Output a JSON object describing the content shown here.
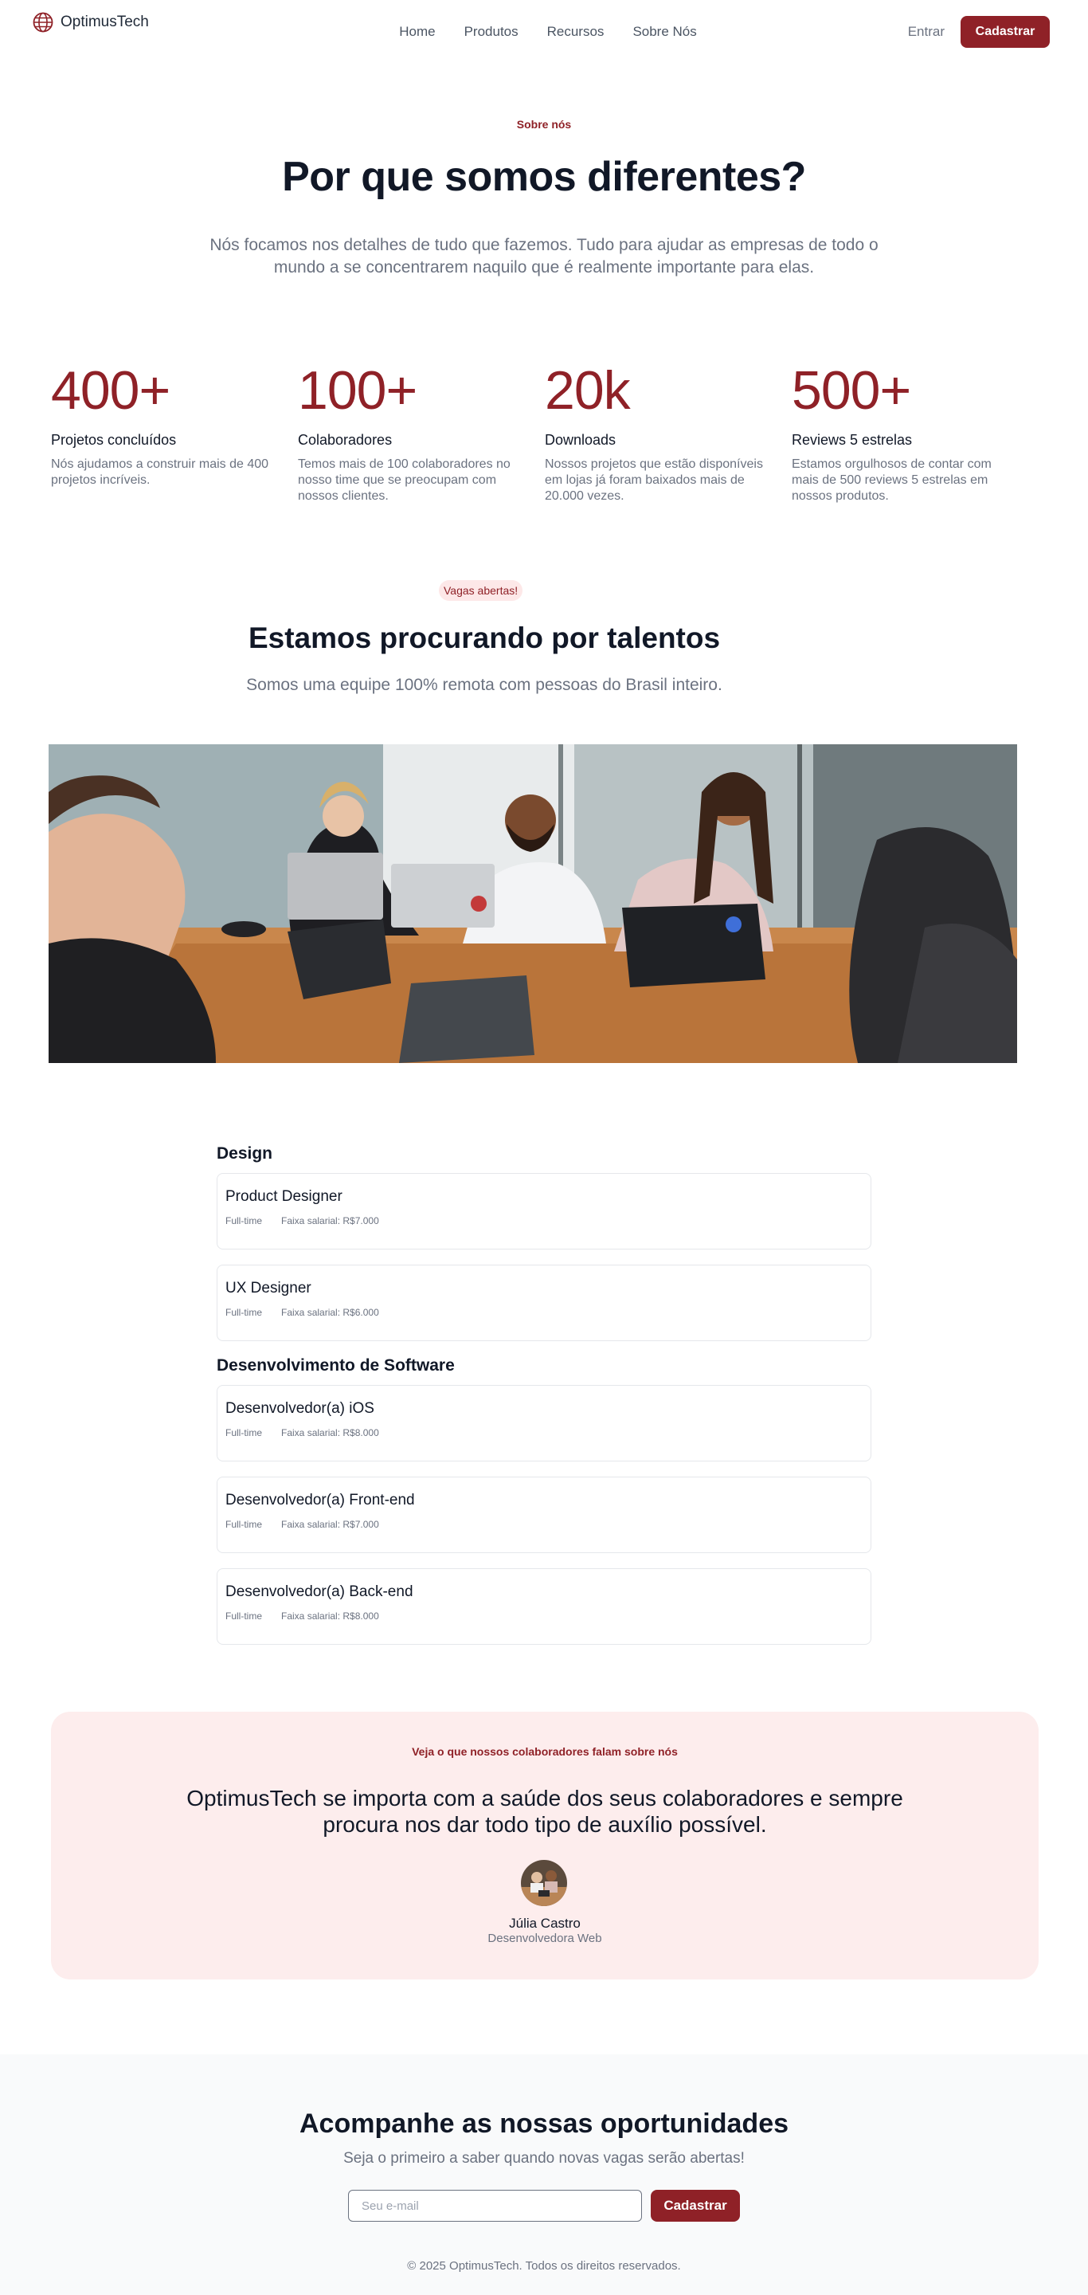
{
  "header": {
    "brand": "OptimusTech",
    "nav": [
      "Home",
      "Produtos",
      "Recursos",
      "Sobre Nós"
    ],
    "login_label": "Entrar",
    "signup_label": "Cadastrar"
  },
  "about": {
    "eyebrow": "Sobre nós",
    "title": "Por que somos diferentes?",
    "description": "Nós focamos nos detalhes de tudo que fazemos. Tudo para ajudar as empresas de todo o mundo a se concentrarem naquilo que é realmente importante para elas."
  },
  "stats": [
    {
      "value": "400+",
      "label": "Projetos concluídos",
      "description": "Nós ajudamos a construir mais de 400 projetos incríveis."
    },
    {
      "value": "100+",
      "label": "Colaboradores",
      "description": "Temos mais de 100 colaboradores no nosso time que se preocupam com nossos clientes."
    },
    {
      "value": "20k",
      "label": "Downloads",
      "description": "Nossos projetos que estão disponíveis em lojas já foram baixados mais de 20.000 vezes."
    },
    {
      "value": "500+",
      "label": "Reviews 5 estrelas",
      "description": "Estamos orgulhosos de contar com mais de 500 reviews 5 estrelas em nossos produtos."
    }
  ],
  "careers": {
    "badge": "Vagas abertas!",
    "title": "Estamos procurando por talentos",
    "subtitle": "Somos uma equipe 100% remota com pessoas do Brasil inteiro."
  },
  "departments": [
    {
      "name": "Design",
      "jobs": [
        {
          "title": "Product Designer",
          "type": "Full-time",
          "salary": "Faixa salarial: R$7.000"
        },
        {
          "title": "UX Designer",
          "type": "Full-time",
          "salary": "Faixa salarial: R$6.000"
        }
      ]
    },
    {
      "name": "Desenvolvimento de Software",
      "jobs": [
        {
          "title": "Desenvolvedor(a) iOS",
          "type": "Full-time",
          "salary": "Faixa salarial: R$8.000"
        },
        {
          "title": "Desenvolvedor(a) Front-end",
          "type": "Full-time",
          "salary": "Faixa salarial: R$7.000"
        },
        {
          "title": "Desenvolvedor(a) Back-end",
          "type": "Full-time",
          "salary": "Faixa salarial: R$8.000"
        }
      ]
    }
  ],
  "testimonial": {
    "eyebrow": "Veja o que nossos colaboradores falam sobre nós",
    "quote": "OptimusTech se importa com a saúde dos seus colaboradores e sempre procura nos dar todo tipo de auxílio possível.",
    "name": "Júlia Castro",
    "role": "Desenvolvedora Web"
  },
  "newsletter": {
    "title": "Acompanhe as nossas oportunidades",
    "subtitle": "Seja o primeiro a saber quando novas vagas serão abertas!",
    "email_placeholder": "Seu e-mail",
    "email_value": "",
    "button_label": "Cadastrar"
  },
  "footer": {
    "copyright": "© 2025 OptimusTech. Todos os direitos reservados."
  },
  "colors": {
    "accent": "#8f2127",
    "accent_soft": "#fdeded",
    "text": "#111827",
    "muted": "#6b7280"
  },
  "icons": {
    "logo": "globe-icon"
  }
}
